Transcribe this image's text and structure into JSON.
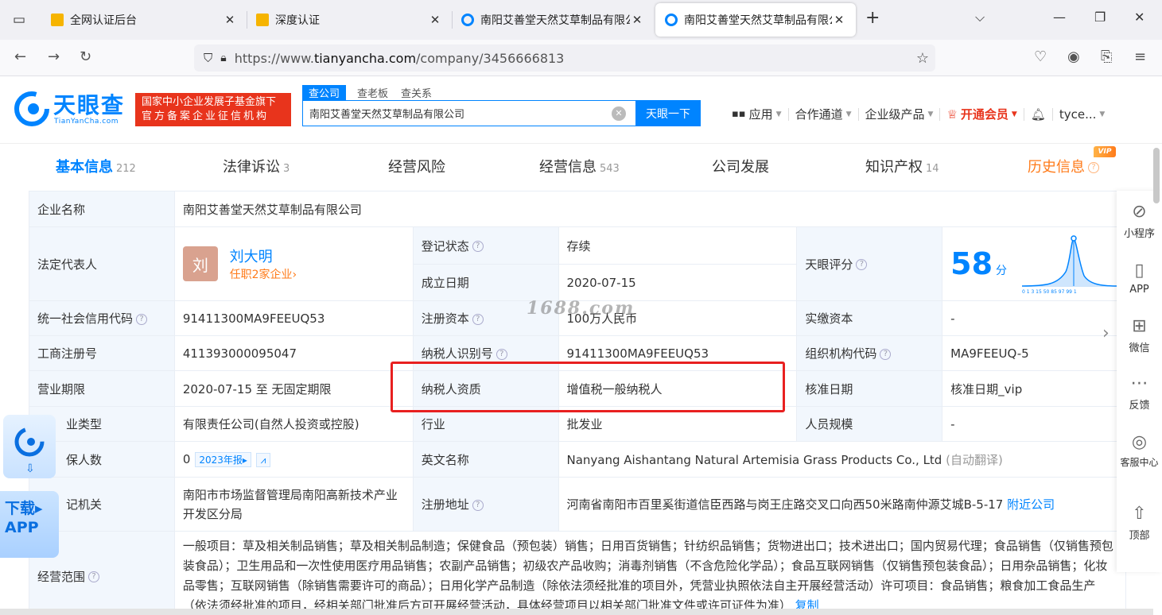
{
  "browser": {
    "tabs": [
      {
        "title": "全网认证后台",
        "fav": "yellow"
      },
      {
        "title": "深度认证",
        "fav": "yellow"
      },
      {
        "title": "南阳艾善堂天然艾草制品有限公",
        "fav": "blue"
      },
      {
        "title": "南阳艾善堂天然艾草制品有限公",
        "fav": "blue",
        "active": true
      }
    ],
    "url_prefix": "https://www.",
    "url_domain": "tianyancha.com",
    "url_path": "/company/3456666813"
  },
  "site": {
    "logo_cn": "天眼查",
    "logo_en": "TianYanCha.com",
    "badge_line1": "国家中小企业发展子基金旗下",
    "badge_line2": "官方备案企业征信机构",
    "search_tabs": [
      "查公司",
      "查老板",
      "查关系"
    ],
    "search_value": "南阳艾善堂天然艾草制品有限公司",
    "search_button": "天眼一下",
    "nav": {
      "apps": "应用",
      "partner": "合作通道",
      "enterprise": "企业级产品",
      "vip": "开通会员",
      "user": "tyce..."
    }
  },
  "content_tabs": [
    {
      "label": "基本信息",
      "count": "212"
    },
    {
      "label": "法律诉讼",
      "count": "3"
    },
    {
      "label": "经营风险",
      "count": ""
    },
    {
      "label": "经营信息",
      "count": "543"
    },
    {
      "label": "公司发展",
      "count": ""
    },
    {
      "label": "知识产权",
      "count": "14"
    },
    {
      "label": "历史信息",
      "count": ""
    }
  ],
  "vip_badge": "VIP",
  "info": {
    "company_name_k": "企业名称",
    "company_name_v": "南阳艾善堂天然艾草制品有限公司",
    "legal_rep_k": "法定代表人",
    "legal_rep_avatar": "刘",
    "legal_rep_name": "刘大明",
    "legal_rep_jobs": "任职2家企业›",
    "reg_status_k": "登记状态",
    "reg_status_v": "存续",
    "found_date_k": "成立日期",
    "found_date_v": "2020-07-15",
    "score_k": "天眼评分",
    "score_v": "58",
    "score_u": "分",
    "credit_code_k": "统一社会信用代码",
    "credit_code_v": "91411300MA9FEEUQ53",
    "reg_capital_k": "注册资本",
    "reg_capital_v": "100万人民币",
    "paid_capital_k": "实缴资本",
    "paid_capital_v": "-",
    "biz_reg_no_k": "工商注册号",
    "biz_reg_no_v": "411393000095047",
    "tax_id_k": "纳税人识别号",
    "tax_id_v": "91411300MA9FEEUQ53",
    "org_code_k": "组织机构代码",
    "org_code_v": "MA9FEEUQ-5",
    "term_k": "营业期限",
    "term_v": "2020-07-15 至 无固定期限",
    "tax_qual_k": "纳税人资质",
    "tax_qual_v": "增值税一般纳税人",
    "approve_k": "核准日期",
    "approve_v": "核准日期_vip",
    "type_k": "业类型",
    "type_v": "有限责任公司(自然人投资或控股)",
    "industry_k": "行业",
    "industry_v": "批发业",
    "staff_k": "人员规模",
    "staff_v": "-",
    "insured_k": "保人数",
    "insured_v": "0",
    "insured_year": "2023年报▸",
    "en_name_k": "英文名称",
    "en_name_v": "Nanyang Aishantang Natural Artemisia Grass Products Co., Ltd",
    "en_name_note": "(自动翻译)",
    "authority_k": "记机关",
    "authority_v": "南阳市市场监督管理局南阳高新技术产业开发区分局",
    "address_k": "注册地址",
    "address_v": "河南省南阳市百里奚街道信臣西路与岗王庄路交叉口向西50米路南仲源艾城B-5-17",
    "address_link": "附近公司",
    "scope_k": "经营范围",
    "scope_v": "一般项目：草及相关制品销售；草及相关制品制造；保健食品（预包装）销售；日用百货销售；针纺织品销售；货物进出口；技术进出口；国内贸易代理；食品销售（仅销售预包装食品）；卫生用品和一次性使用医疗用品销售；农副产品销售；初级农产品收购；消毒剂销售（不含危险化学品）；食品互联网销售（仅销售预包装食品）；日用杂品销售；化妆品零售；互联网销售（除销售需要许可的商品）；日用化学产品制造（除依法须经批准的项目外，凭营业执照依法自主开展经营活动）许可项目：食品销售；粮食加工食品生产（依法须经批准的项目，经相关部门批准后方可开展经营活动，具体经营项目以相关部门批准文件或许可证件为准）",
    "scope_more": "复制"
  },
  "watermark": "1688.com",
  "right_panel": [
    "小程序",
    "APP",
    "微信",
    "反馈",
    "客服中心",
    "顶部"
  ],
  "download": {
    "line1": "下载▸",
    "line2": "APP"
  }
}
